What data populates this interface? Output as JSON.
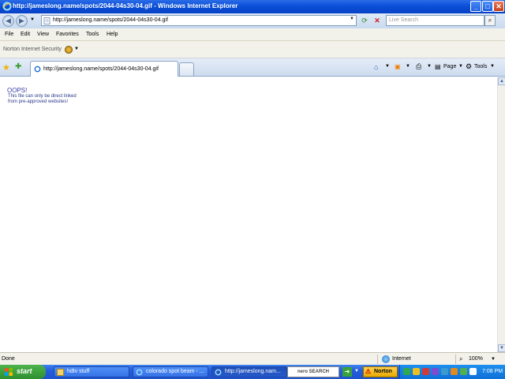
{
  "window": {
    "title": "http://jameslong.name/spots/2044-04s30-04.gif - Windows Internet Explorer",
    "minimize": "_",
    "maximize": "□",
    "close": "✕"
  },
  "address": {
    "url": "http://jameslong.name/spots/2044-04s30-04.gif",
    "search_placeholder": "Live Search"
  },
  "menu": [
    "File",
    "Edit",
    "View",
    "Favorites",
    "Tools",
    "Help"
  ],
  "norton_toolbar": {
    "label": "Norton Internet Security"
  },
  "tabs": [
    {
      "label": "http://jameslong.name/spots/2044-04s30-04.gif",
      "active": true
    }
  ],
  "command_bar": {
    "page": "Page",
    "tools": "Tools"
  },
  "content": {
    "heading": "OOPS!",
    "line1": "This file can only be direct linked",
    "line2": "from pre-approved websites!"
  },
  "status": {
    "text": "Done",
    "zone": "Internet",
    "zoom": "100%"
  },
  "taskbar": {
    "start": "start",
    "tasks": [
      {
        "label": "hdtv stuff",
        "icon": "folder-icon",
        "active": false
      },
      {
        "label": "colorado spot beam - ...",
        "icon": "ie-icon",
        "active": false
      },
      {
        "label": "http://jameslong.nam...",
        "icon": "ie-icon",
        "active": true
      }
    ],
    "nero": "nero SEARCH",
    "norton": "Norton",
    "clock": "7:08 PM"
  },
  "colors": {
    "titlebar": "#0a4fd6",
    "taskbar": "#245edb",
    "start_button": "#2f8f2f",
    "content_text": "#3a3aa4"
  }
}
